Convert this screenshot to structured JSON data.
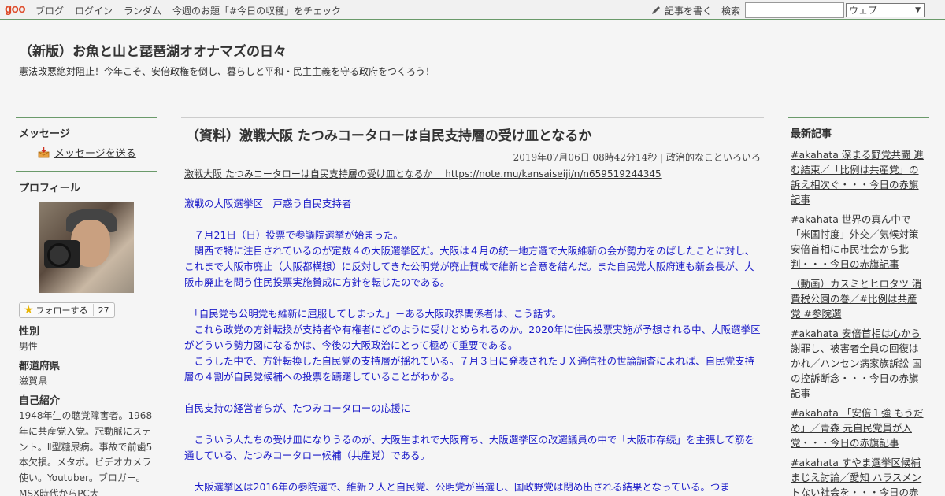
{
  "topbar": {
    "logo": "goo",
    "links": [
      "ブログ",
      "ログイン",
      "ランダム",
      "今週のお題「#今日の収穫」をチェック"
    ],
    "write_label": "記事を書く",
    "search_label": "検索",
    "search_value": "",
    "search_scope": "ウェブ"
  },
  "header": {
    "title": "（新版）お魚と山と琵琶湖オオナマズの日々",
    "description": "憲法改悪絶対阻止！今年こそ、安倍政権を倒し、暮らしと平和・民主主義を守る政府をつくろう！"
  },
  "sidebar_left": {
    "message_heading": "メッセージ",
    "message_link": "メッセージを送る",
    "profile_heading": "プロフィール",
    "follow_label": "フォローする",
    "follow_count": "27",
    "gender_label": "性別",
    "gender_value": "男性",
    "prefecture_label": "都道府県",
    "prefecture_value": "滋賀県",
    "intro_label": "自己紹介",
    "intro_value": "1948年生の聴覚障害者。1968年に共産党入党。冠動脈にステント。Ⅱ型糖尿病。事故で前歯5本欠損。メタボ。ビデオカメラ使い。Youtuber。ブロガー。MSX時代からPC大"
  },
  "post": {
    "title": "（資料）激戦大阪 たつみコータローは自民支持層の受け皿となるか",
    "meta": "2019年07月06日 08時42分14秒 | 政治的なこといろいろ",
    "source_link": "激戦大阪 たつみコータローは自民支持層の受け皿となるか　 https://note.mu/kansaiseiji/n/n659519244345",
    "paragraphs": [
      "激戦の大阪選挙区　戸惑う自民支持者",
      "　７月21日（日）投票で参議院選挙が始まった。\n　関西で特に注目されているのが定数４の大阪選挙区だ。大阪は４月の統一地方選で大阪維新の会が勢力をのばしたことに対し、これまで大阪市廃止（大阪都構想）に反対してきた公明党が廃止賛成で維新と合意を結んだ。また自民党大阪府連も新会長が、大阪市廃止を問う住民投票実施賛成に方針を転じたのである。",
      "　「自民党も公明党も維新に屈服してしまった」－ある大阪政界関係者は、こう話す。\n　これら政党の方針転換が支持者や有権者にどのように受けとめられるのか。2020年に住民投票実施が予想される中、大阪選挙区がどういう勢力図になるかは、今後の大阪政治にとって極めて重要である。\n　こうした中で、方針転換した自民党の支持層が揺れている。７月３日に発表されたＪＸ通信社の世論調査によれば、自民党支持層の４割が自民党候補への投票を躊躇していることがわかる。",
      "自民支持の経営者らが、たつみコータローの応援に",
      "　こういう人たちの受け皿になりうるのが、大阪生まれで大阪育ち、大阪選挙区の改選議員の中で「大阪市存続」を主張して筋を通している、たつみコータロー候補（共産党）である。",
      "　大阪選挙区は2016年の参院選で、維新２人と自民党、公明党が当選し、国政野党は閉め出される結果となっている。つま"
    ]
  },
  "sidebar_right": {
    "recent_heading": "最新記事",
    "recent": [
      "#akahata 深まる野党共闘 進む結束／「比例は共産党」の訴え相次ぐ・・・今日の赤旗記事",
      "#akahata 世界の真ん中で 「米国忖度」外交／気候対策 安倍首相に市民社会から批判・・・今日の赤旗記事",
      "（動画）カスミとヒロタツ 消費税公園の巻／#比例は共産党 #参院選",
      "#akahata 安倍首相は心から謝罪し、被害者全員の回復はかれ／ハンセン病家族訴訟 国の控訴断念・・・今日の赤旗記事",
      "#akahata 「安倍１強 もうだめ」／青森 元自民党員が入党・・・今日の赤旗記事",
      "#akahata すやま選挙区候補まじえ討論／愛知 ハラスメントない社会を・・・今日の赤旗記事"
    ]
  }
}
